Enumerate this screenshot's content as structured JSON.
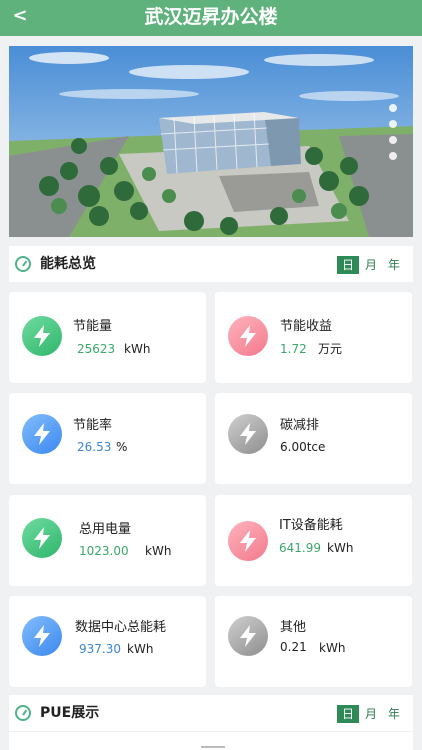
{
  "header": {
    "title": "武汉迈昇办公楼",
    "back_label": "<"
  },
  "energy_overview": {
    "title": "能耗总览",
    "tabs": [
      "日",
      "月",
      "年"
    ],
    "active_tab": "日"
  },
  "metrics": [
    {
      "label": "节能量",
      "value": "25623",
      "unit": "kWh",
      "icon_color": "green",
      "value_color": "green",
      "icon": "lightning-icon"
    },
    {
      "label": "节能收益",
      "value": "1.72",
      "unit": "万元",
      "icon_color": "pink",
      "value_color": "green",
      "icon": "lightning-icon"
    },
    {
      "label": "节能率",
      "value": "26.53",
      "unit": "%",
      "icon_color": "blue",
      "value_color": "blue",
      "icon": "lightning-icon"
    },
    {
      "label": "碳减排",
      "value": "6.00tce",
      "unit": "",
      "icon_color": "gray",
      "value_color": "dark",
      "icon": "lightning-icon"
    },
    {
      "label": "总用电量",
      "value": "1023.00",
      "unit": "kWh",
      "icon_color": "green",
      "value_color": "green",
      "icon": "lightning-icon"
    },
    {
      "label": "IT设备能耗",
      "value": "641.99",
      "unit": "kWh",
      "icon_color": "pink",
      "value_color": "green",
      "icon": "lightning-icon"
    },
    {
      "label": "数据中心总能耗",
      "value": "937.30",
      "unit": "kWh",
      "icon_color": "blue",
      "value_color": "blue",
      "icon": "lightning-icon"
    },
    {
      "label": "其他",
      "value": "0.21",
      "unit": "kWh",
      "icon_color": "gray",
      "value_color": "dark",
      "icon": "lightning-icon"
    }
  ],
  "pue_section": {
    "title": "PUE展示",
    "tabs": [
      "日",
      "月",
      "年"
    ],
    "active_tab": "日"
  },
  "colors": {
    "header_bg": "#5fb27c",
    "active_tab_bg": "#2e8b57",
    "green_value": "#3aa86a",
    "blue_value": "#3c86d6"
  }
}
